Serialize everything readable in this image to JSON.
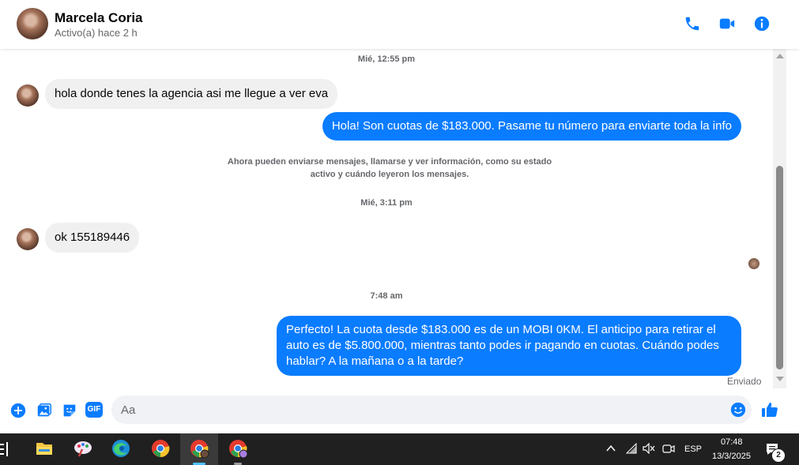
{
  "header": {
    "name": "Marcela Coria",
    "status": "Activo(a) hace 2 h"
  },
  "messages": {
    "time1": "Mié, 12:55 pm",
    "incoming1": "hola donde tenes la agencia asi me llegue a ver eva",
    "outgoing1": "Hola! Son cuotas de $183.000. Pasame tu número para enviarte toda la info",
    "system_line1": "Ahora pueden enviarse mensajes, llamarse y ver información, como su estado",
    "system_line2": "activo y cuándo leyeron los mensajes.",
    "time2": "Mié, 3:11 pm",
    "incoming2": "ok 155189446",
    "time3": "7:48 am",
    "outgoing2_line1": "Perfecto! La cuota desde $183.000 es de un MOBI 0KM. El anticipo para retirar el",
    "outgoing2_line2": "auto es de $5.800.000, mientras tanto podes ir pagando en cuotas. Cuándo podes",
    "outgoing2_line3": "hablar? A la mañana o a la tarde?",
    "sent_status": "Enviado"
  },
  "composer": {
    "placeholder": "Aa",
    "gif_label": "GIF"
  },
  "taskbar": {
    "language": "ESP",
    "time": "07:48",
    "date": "13/3/2025",
    "notification_count": "2"
  },
  "colors": {
    "accent": "#0a7cff",
    "incoming_bg": "#f0f0f0",
    "taskbar_bg": "#202020"
  }
}
